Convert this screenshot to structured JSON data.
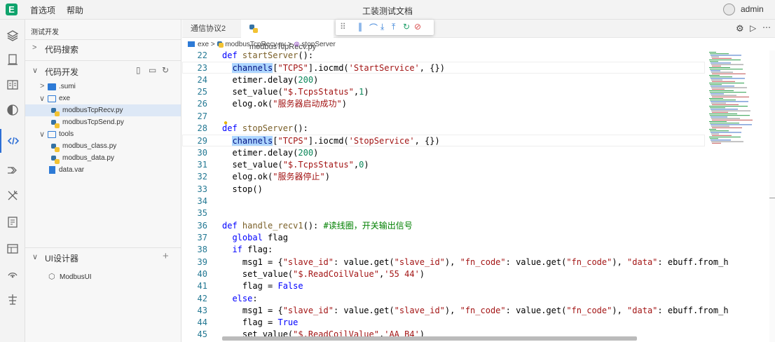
{
  "titlebar": {
    "menu": [
      "首选项",
      "帮助"
    ],
    "title": "工装测试文档",
    "user": "admin"
  },
  "activity": {
    "items": [
      "extensions-icon",
      "files-icon",
      "document-icon",
      "contrast-icon",
      "code-icon",
      "flow-icon",
      "tools-icon",
      "template-icon",
      "layout-icon",
      "signal-icon",
      "system-icon"
    ]
  },
  "sidebar": {
    "header": "测试开发",
    "code_search": "代码搜索",
    "code_dev": "代码开发",
    "tree": [
      {
        "label": ".sumi",
        "type": "folder"
      },
      {
        "label": "exe",
        "type": "folder-open"
      },
      {
        "label": "modbusTcpRecv.py",
        "type": "py"
      },
      {
        "label": "modbusTcpSend.py",
        "type": "py"
      },
      {
        "label": "tools",
        "type": "folder-open"
      },
      {
        "label": "modbus_class.py",
        "type": "py"
      },
      {
        "label": "modbus_data.py",
        "type": "py"
      },
      {
        "label": "data.var",
        "type": "file"
      }
    ],
    "ui_designer": "UI设计器",
    "ui_item": "ModbusUI"
  },
  "editor": {
    "tabs": [
      "通信协议2",
      "modbusTcpRecv.py"
    ],
    "breadcrumb": [
      "exe",
      "modbusTcpRecv.py",
      "stopServer"
    ],
    "line_numbers": [
      "22",
      "23",
      "24",
      "25",
      "26",
      "27",
      "28",
      "29",
      "30",
      "31",
      "32",
      "33",
      "34",
      "35",
      "36",
      "37",
      "38",
      "39",
      "40",
      "41",
      "42",
      "43",
      "44",
      "45"
    ],
    "code": {
      "l22a": "def ",
      "l22b": "startServer",
      "l22c": "():",
      "l23a": "  ",
      "l23b": "channels",
      "l23c": "[",
      "l23d": "\"TCPS\"",
      "l23e": "].iocmd(",
      "l23f": "'StartService'",
      "l23g": ", {})",
      "l24a": "  etimer.delay(",
      "l24b": "200",
      "l24c": ")",
      "l25a": "  set_value(",
      "l25b": "\"$.TcpsStatus\"",
      "l25c": ",",
      "l25d": "1",
      "l25e": ")",
      "l26a": "  elog.ok(",
      "l26b": "\"服务器启动成功\"",
      "l26c": ")",
      "l28a": "def ",
      "l28b": "stopServer",
      "l28c": "():",
      "l29a": "  ",
      "l29b": "channels",
      "l29c": "[",
      "l29d": "\"TCPS\"",
      "l29e": "].iocmd(",
      "l29f": "'StopService'",
      "l29g": ", {})",
      "l30a": "  etimer.delay(",
      "l30b": "200",
      "l30c": ")",
      "l31a": "  set_value(",
      "l31b": "\"$.TcpsStatus\"",
      "l31c": ",",
      "l31d": "0",
      "l31e": ")",
      "l32a": "  elog.ok(",
      "l32b": "\"服务器停止\"",
      "l32c": ")",
      "l33": "  stop()",
      "l36a": "def ",
      "l36b": "handle_recv1",
      "l36c": "(): ",
      "l36d": "#读线圈，开关输出信号",
      "l37a": "  ",
      "l37b": "global",
      "l37c": " flag",
      "l38a": "  ",
      "l38b": "if",
      "l38c": " flag:",
      "l39a": "    msg1 = {",
      "l39b": "\"slave_id\"",
      "l39c": ": value.get(",
      "l39d": "\"slave_id\"",
      "l39e": "), ",
      "l39f": "\"fn_code\"",
      "l39g": ": value.get(",
      "l39h": "\"fn_code\"",
      "l39i": "), ",
      "l39j": "\"data\"",
      "l39k": ": ebuff.from_h",
      "l40a": "    set_value(",
      "l40b": "\"$.ReadCoilValue\"",
      "l40c": ",",
      "l40d": "'55 44'",
      "l40e": ")",
      "l41a": "    flag = ",
      "l41b": "False",
      "l42a": "  ",
      "l42b": "else",
      ":l42c": "",
      "l42c": ":",
      "l43a": "    msg1 = {",
      "l43b": "\"slave_id\"",
      "l43c": ": value.get(",
      "l43d": "\"slave_id\"",
      "l43e": "), ",
      "l43f": "\"fn_code\"",
      "l43g": ": value.get(",
      "l43h": "\"fn_code\"",
      "l43i": "), ",
      "l43j": "\"data\"",
      "l43k": ": ebuff.from_h",
      "l44a": "    flag = ",
      "l44b": "True",
      "l45a": "    set_value(",
      "l45b": "\"$.ReadCoilValue\"",
      "l45c": ",",
      "l45d": "'AA B4'",
      "l45e": ")"
    }
  },
  "colors": {
    "accent": "#2d7ad6",
    "selected_row": "#dde8f6",
    "logo": "#10a36c"
  }
}
